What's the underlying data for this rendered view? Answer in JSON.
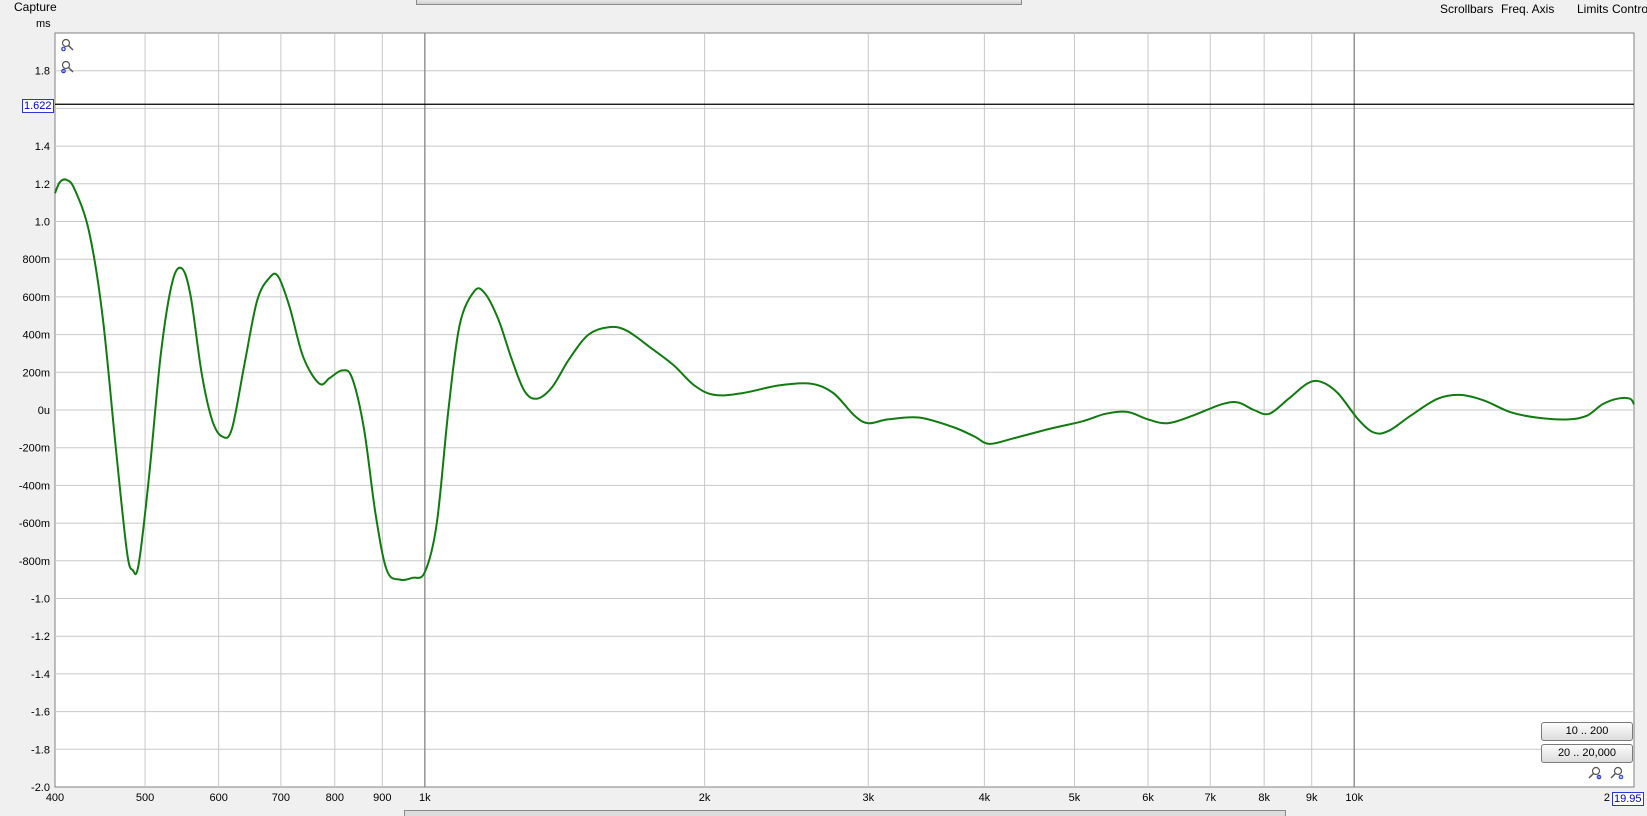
{
  "header": {
    "capture_label": "Capture",
    "units_label": "ms",
    "menu": [
      "Scrollbars",
      "Freq. Axis",
      "Limits",
      "Controls"
    ]
  },
  "cursor": {
    "y_value_label": "1.622",
    "x_value_label": "19.95"
  },
  "range_buttons": [
    "10 .. 200",
    "20 .. 20,000"
  ],
  "colors": {
    "trace": "#107c10",
    "grid": "#c8c8c8",
    "accent_blue": "#2a36d8"
  },
  "icons": [
    "zoom-in-icon",
    "zoom-out-icon"
  ],
  "chart_data": {
    "type": "line",
    "x_scale": "log",
    "xlim": [
      400,
      20000
    ],
    "ylim": [
      -2.0,
      2.0
    ],
    "y_ticks": [
      {
        "v": 1.8,
        "label": "1.8"
      },
      {
        "v": 1.4,
        "label": "1.4"
      },
      {
        "v": 1.2,
        "label": "1.2"
      },
      {
        "v": 1.0,
        "label": "1.0"
      },
      {
        "v": 0.8,
        "label": "800m"
      },
      {
        "v": 0.6,
        "label": "600m"
      },
      {
        "v": 0.4,
        "label": "400m"
      },
      {
        "v": 0.2,
        "label": "200m"
      },
      {
        "v": 0.0,
        "label": "0u"
      },
      {
        "v": -0.2,
        "label": "-200m"
      },
      {
        "v": -0.4,
        "label": "-400m"
      },
      {
        "v": -0.6,
        "label": "-600m"
      },
      {
        "v": -0.8,
        "label": "-800m"
      },
      {
        "v": -1.0,
        "label": "-1.0"
      },
      {
        "v": -1.2,
        "label": "-1.2"
      },
      {
        "v": -1.4,
        "label": "-1.4"
      },
      {
        "v": -1.6,
        "label": "-1.6"
      },
      {
        "v": -1.8,
        "label": "-1.8"
      },
      {
        "v": -2.0,
        "label": "-2.0"
      }
    ],
    "y_gridlines": [
      1.8,
      1.6,
      1.4,
      1.2,
      1.0,
      0.8,
      0.6,
      0.4,
      0.2,
      0.0,
      -0.2,
      -0.4,
      -0.6,
      -0.8,
      -1.0,
      -1.2,
      -1.4,
      -1.6,
      -1.8
    ],
    "x_ticks": [
      {
        "v": 400,
        "label": "400"
      },
      {
        "v": 500,
        "label": "500"
      },
      {
        "v": 600,
        "label": "600"
      },
      {
        "v": 700,
        "label": "700"
      },
      {
        "v": 800,
        "label": "800"
      },
      {
        "v": 900,
        "label": "900"
      },
      {
        "v": 1000,
        "label": "1k"
      },
      {
        "v": 2000,
        "label": "2k"
      },
      {
        "v": 3000,
        "label": "3k"
      },
      {
        "v": 4000,
        "label": "4k"
      },
      {
        "v": 5000,
        "label": "5k"
      },
      {
        "v": 6000,
        "label": "6k"
      },
      {
        "v": 7000,
        "label": "7k"
      },
      {
        "v": 8000,
        "label": "8k"
      },
      {
        "v": 9000,
        "label": "9k"
      },
      {
        "v": 10000,
        "label": "10k"
      },
      {
        "v": 20000,
        "label": "2"
      }
    ],
    "x_major_lines": [
      1000,
      10000
    ],
    "cursor_y": 1.622,
    "series": [
      {
        "color": "#107c10",
        "points": [
          [
            400,
            1.15
          ],
          [
            405,
            1.21
          ],
          [
            412,
            1.22
          ],
          [
            420,
            1.17
          ],
          [
            435,
            0.95
          ],
          [
            450,
            0.5
          ],
          [
            465,
            -0.2
          ],
          [
            478,
            -0.75
          ],
          [
            485,
            -0.85
          ],
          [
            492,
            -0.82
          ],
          [
            505,
            -0.35
          ],
          [
            520,
            0.3
          ],
          [
            535,
            0.68
          ],
          [
            548,
            0.75
          ],
          [
            560,
            0.6
          ],
          [
            575,
            0.2
          ],
          [
            590,
            -0.05
          ],
          [
            605,
            -0.14
          ],
          [
            620,
            -0.1
          ],
          [
            640,
            0.25
          ],
          [
            660,
            0.58
          ],
          [
            680,
            0.7
          ],
          [
            695,
            0.71
          ],
          [
            715,
            0.55
          ],
          [
            740,
            0.28
          ],
          [
            770,
            0.14
          ],
          [
            790,
            0.17
          ],
          [
            815,
            0.21
          ],
          [
            835,
            0.17
          ],
          [
            860,
            -0.1
          ],
          [
            885,
            -0.55
          ],
          [
            910,
            -0.85
          ],
          [
            940,
            -0.9
          ],
          [
            970,
            -0.89
          ],
          [
            1000,
            -0.86
          ],
          [
            1030,
            -0.6
          ],
          [
            1060,
            0.0
          ],
          [
            1090,
            0.45
          ],
          [
            1130,
            0.63
          ],
          [
            1160,
            0.62
          ],
          [
            1200,
            0.48
          ],
          [
            1240,
            0.27
          ],
          [
            1280,
            0.1
          ],
          [
            1320,
            0.06
          ],
          [
            1370,
            0.12
          ],
          [
            1430,
            0.27
          ],
          [
            1500,
            0.4
          ],
          [
            1580,
            0.44
          ],
          [
            1650,
            0.42
          ],
          [
            1750,
            0.33
          ],
          [
            1850,
            0.24
          ],
          [
            1950,
            0.13
          ],
          [
            2050,
            0.08
          ],
          [
            2200,
            0.09
          ],
          [
            2400,
            0.13
          ],
          [
            2600,
            0.14
          ],
          [
            2750,
            0.09
          ],
          [
            2900,
            -0.03
          ],
          [
            3000,
            -0.07
          ],
          [
            3150,
            -0.05
          ],
          [
            3400,
            -0.04
          ],
          [
            3700,
            -0.09
          ],
          [
            3900,
            -0.14
          ],
          [
            4050,
            -0.18
          ],
          [
            4300,
            -0.15
          ],
          [
            4700,
            -0.1
          ],
          [
            5100,
            -0.06
          ],
          [
            5400,
            -0.02
          ],
          [
            5700,
            -0.01
          ],
          [
            6000,
            -0.05
          ],
          [
            6300,
            -0.07
          ],
          [
            6700,
            -0.03
          ],
          [
            7200,
            0.03
          ],
          [
            7500,
            0.04
          ],
          [
            7800,
            0.0
          ],
          [
            8100,
            -0.02
          ],
          [
            8500,
            0.06
          ],
          [
            8900,
            0.14
          ],
          [
            9200,
            0.15
          ],
          [
            9600,
            0.09
          ],
          [
            10100,
            -0.05
          ],
          [
            10500,
            -0.12
          ],
          [
            10900,
            -0.11
          ],
          [
            11500,
            -0.03
          ],
          [
            12300,
            0.06
          ],
          [
            13000,
            0.08
          ],
          [
            13800,
            0.05
          ],
          [
            14700,
            -0.01
          ],
          [
            15700,
            -0.04
          ],
          [
            17000,
            -0.05
          ],
          [
            17800,
            -0.03
          ],
          [
            18500,
            0.03
          ],
          [
            19200,
            0.06
          ],
          [
            19800,
            0.06
          ],
          [
            20000,
            0.03
          ]
        ]
      }
    ]
  }
}
